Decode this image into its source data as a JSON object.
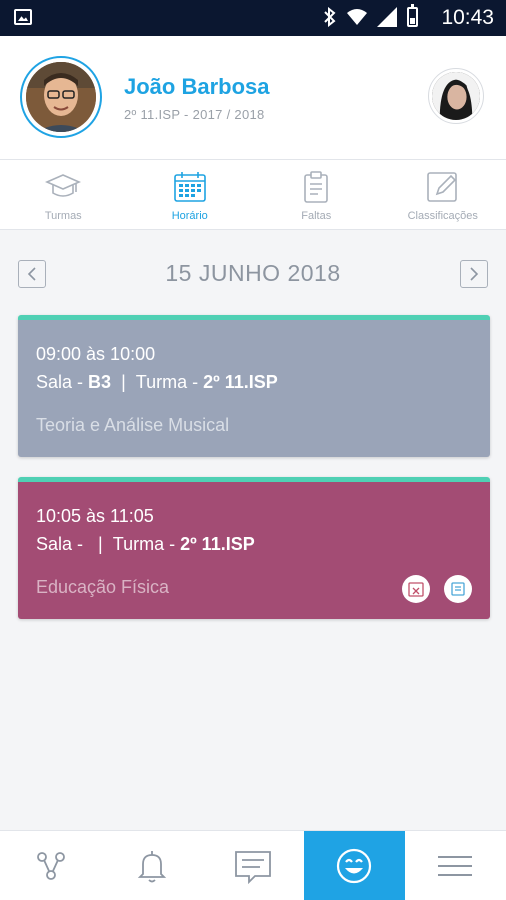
{
  "status_bar": {
    "time": "10:43"
  },
  "profile": {
    "name": "João Barbosa",
    "subtitle": "2º 11.ISP - 2017 / 2018"
  },
  "tabs": [
    {
      "label": "Turmas",
      "icon": "graduation-cap-icon",
      "active": false
    },
    {
      "label": "Horário",
      "icon": "calendar-icon",
      "active": true
    },
    {
      "label": "Faltas",
      "icon": "clipboard-icon",
      "active": false
    },
    {
      "label": "Classificações",
      "icon": "pencil-icon",
      "active": false
    }
  ],
  "date_nav": {
    "date": "15 JUNHO 2018"
  },
  "lessons": [
    {
      "time": "09:00 às 10:00",
      "room_label": "Sala - ",
      "room": "B3",
      "separator": "|",
      "class_label": "Turma - ",
      "class": "2º 11.ISP",
      "subject": "Teoria e Análise Musical",
      "color": "#9aa4b8"
    },
    {
      "time": "10:05 às 11:05",
      "room_label": "Sala - ",
      "room": "",
      "separator": "|",
      "class_label": "Turma - ",
      "class": "2º 11.ISP",
      "subject": "Educação Física",
      "color": "#a34c74",
      "icons": [
        "calendar-x-icon",
        "note-icon"
      ]
    }
  ],
  "bottom_nav": [
    {
      "icon": "share-graph-icon",
      "active": false
    },
    {
      "icon": "bell-icon",
      "active": false
    },
    {
      "icon": "chat-icon",
      "active": false
    },
    {
      "icon": "smiley-icon",
      "active": true
    },
    {
      "icon": "menu-icon",
      "active": false
    }
  ],
  "colors": {
    "accent": "#1ea3e2",
    "card_top_border": "#4fd0b4",
    "status_bar": "#0b1730"
  }
}
